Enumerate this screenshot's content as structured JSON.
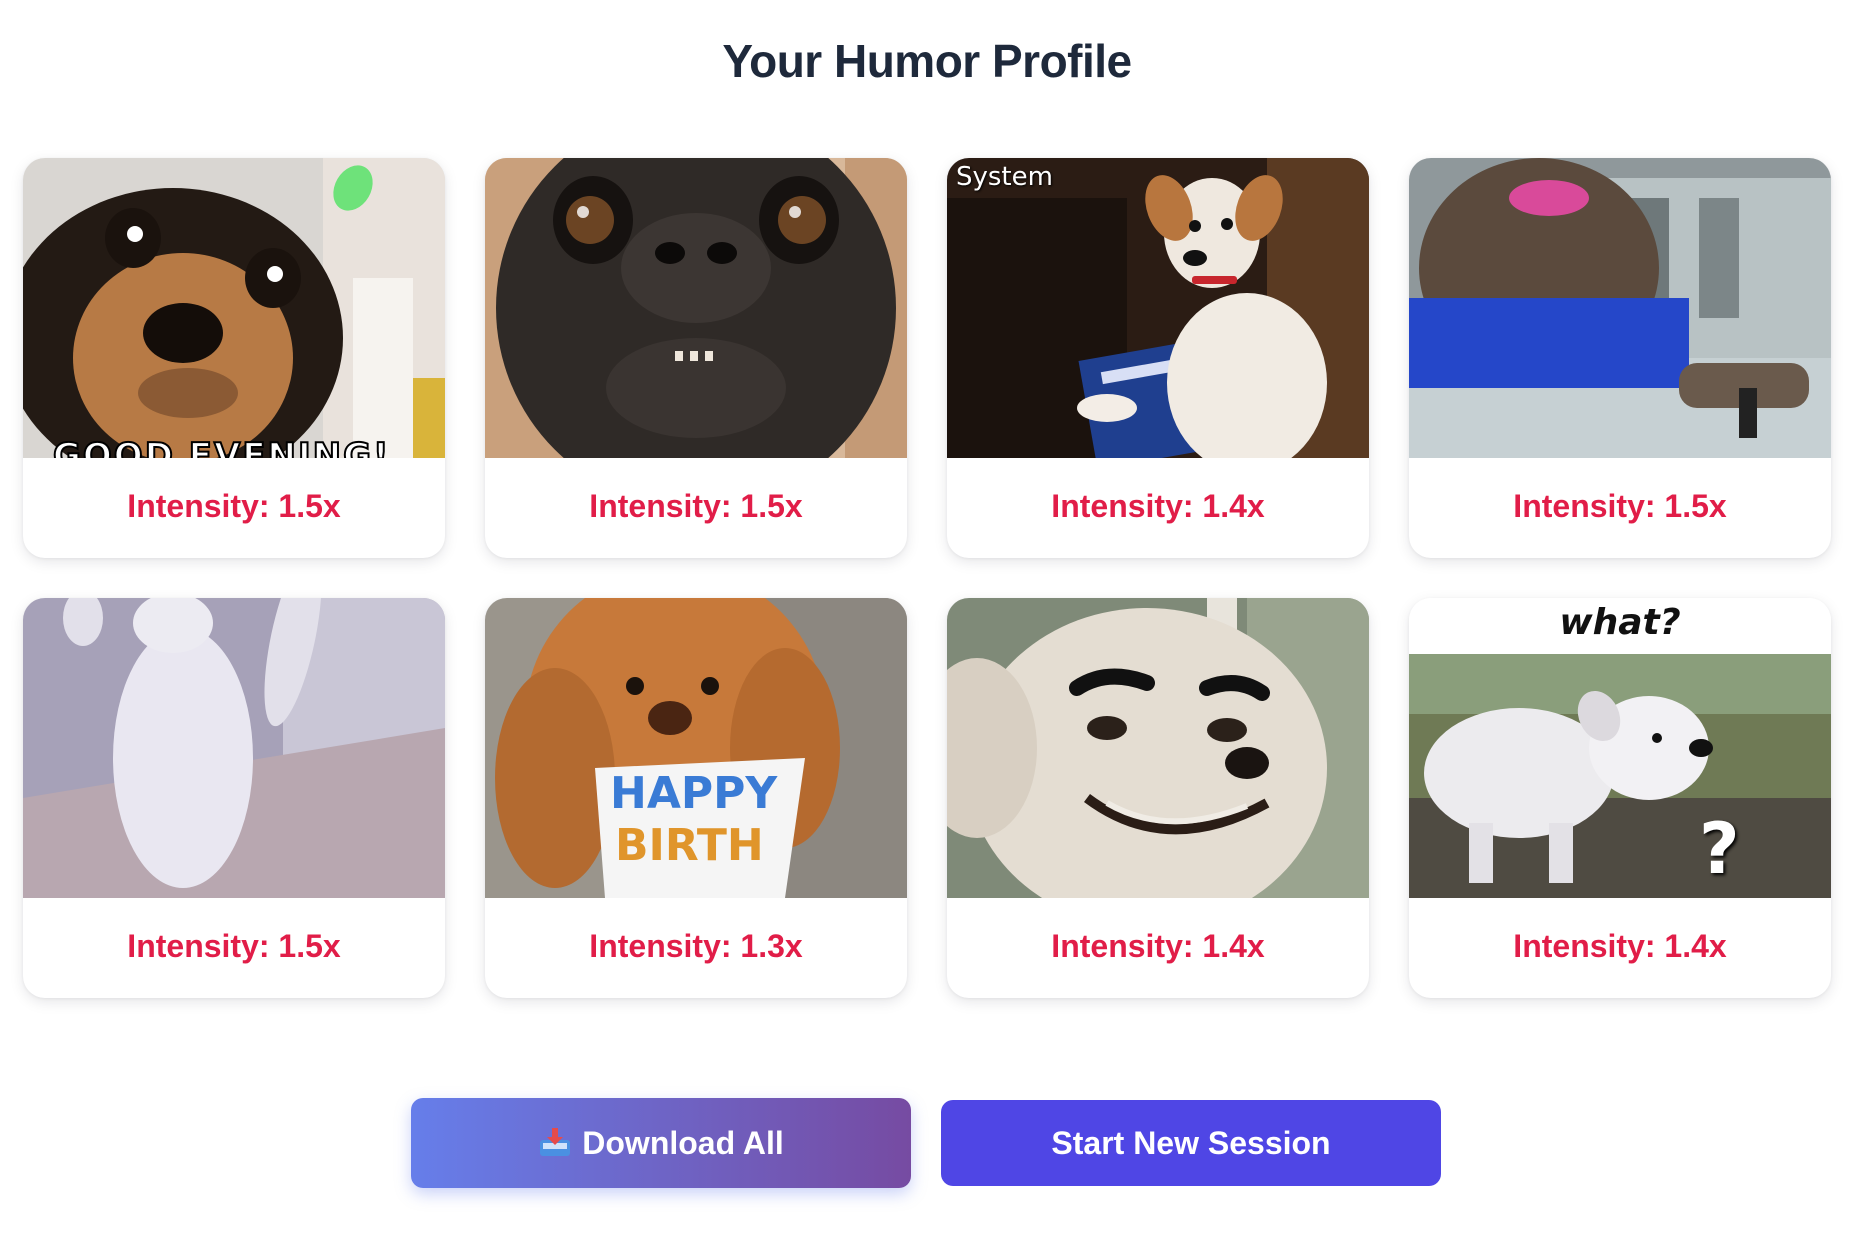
{
  "page": {
    "title": "Your Humor Profile"
  },
  "cards": [
    {
      "image": "chihuahua-good-evening",
      "caption": "GOOD EVENING!",
      "intensity": "Intensity: 1.5x"
    },
    {
      "image": "pug-closeup-face",
      "caption": "",
      "intensity": "Intensity: 1.5x"
    },
    {
      "image": "jack-russell-with-beer-box",
      "caption": "System",
      "intensity": "Intensity: 1.4x"
    },
    {
      "image": "seal-in-car-sunglasses",
      "caption": "",
      "intensity": "Intensity: 1.5x"
    },
    {
      "image": "white-kitten-dancing",
      "caption": "",
      "intensity": "Intensity: 1.5x"
    },
    {
      "image": "doodle-puppy-happy-birthday",
      "caption": "HAPPY BIRTH-DAY!",
      "intensity": "Intensity: 1.3x"
    },
    {
      "image": "chihuahua-with-eyebrows",
      "caption": "",
      "intensity": "Intensity: 1.4x"
    },
    {
      "image": "confused-white-dog-what",
      "caption": "what?",
      "intensity": "Intensity: 1.4x"
    }
  ],
  "actions": {
    "download_icon": "inbox-tray-icon",
    "download_label": "Download All",
    "new_session_label": "Start New Session"
  },
  "colors": {
    "title": "#1e293b",
    "intensity": "#e11d48",
    "download_gradient_start": "#667eea",
    "download_gradient_end": "#764ba2",
    "new_session": "#4f46e5"
  }
}
